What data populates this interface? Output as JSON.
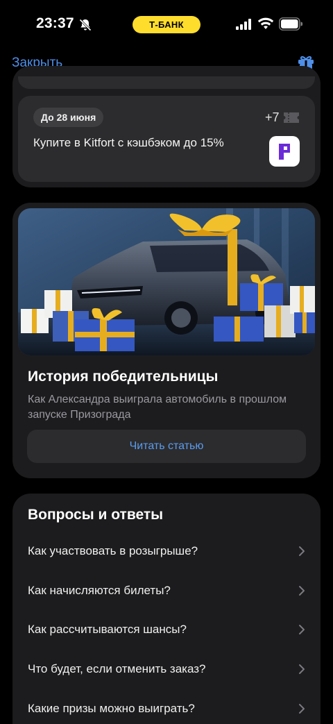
{
  "status": {
    "time": "23:37",
    "carrier": "Т-БАНК"
  },
  "nav": {
    "close_label": "Закрыть",
    "gift_icon": "gift-icon"
  },
  "promo": {
    "date_chip": "До 28 июня",
    "tickets": "+7",
    "text": "Купите в Kitfort с кэшбэком до 15%",
    "brand_color": "#6b2bd9"
  },
  "story": {
    "title": "История победительницы",
    "subtitle": "Как Александра выиграла автомобиль в прошлом запуске Призограда",
    "button_label": "Читать статью"
  },
  "faq": {
    "title": "Вопросы и ответы",
    "items": [
      {
        "q": "Как участвовать в розыгрыше?"
      },
      {
        "q": "Как начисляются билеты?"
      },
      {
        "q": "Как рассчитываются шансы?"
      },
      {
        "q": "Что будет, если отменить заказ?"
      },
      {
        "q": "Какие призы можно выиграть?"
      }
    ]
  },
  "colors": {
    "accent": "#4f8fe8",
    "carrier_badge": "#ffdd2d",
    "card_bg": "#1c1c1e",
    "inner_bg": "#2c2c2e"
  }
}
